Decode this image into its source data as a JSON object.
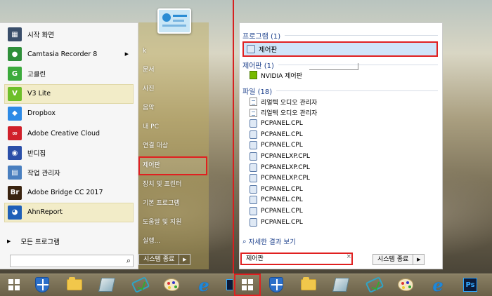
{
  "left_menu": {
    "apps": [
      {
        "label": "시작 화면",
        "icon": "start-screen-icon",
        "color": "#3a4e6a",
        "glyph": "▦",
        "arrow": false,
        "highlight": false
      },
      {
        "label": "Camtasia Recorder 8",
        "icon": "camtasia-icon",
        "color": "#2f8f3a",
        "glyph": "●",
        "arrow": true,
        "highlight": false
      },
      {
        "label": "고클린",
        "icon": "goclean-icon",
        "color": "#3caa3c",
        "glyph": "G",
        "arrow": false,
        "highlight": false
      },
      {
        "label": "V3 Lite",
        "icon": "v3-icon",
        "color": "#6dbf2a",
        "glyph": "V",
        "arrow": false,
        "highlight": true
      },
      {
        "label": "Dropbox",
        "icon": "dropbox-icon",
        "color": "#2d8ae6",
        "glyph": "◆",
        "arrow": false,
        "highlight": false
      },
      {
        "label": "Adobe Creative Cloud",
        "icon": "creative-cloud-icon",
        "color": "#d0202a",
        "glyph": "∞",
        "arrow": false,
        "highlight": false
      },
      {
        "label": "반디집",
        "icon": "bandizip-icon",
        "color": "#2b4fa8",
        "glyph": "◉",
        "arrow": false,
        "highlight": false
      },
      {
        "label": "작업 관리자",
        "icon": "task-manager-icon",
        "color": "#4a7fbf",
        "glyph": "▤",
        "arrow": false,
        "highlight": false
      },
      {
        "label": "Adobe Bridge CC 2017",
        "icon": "adobe-bridge-icon",
        "color": "#3a2410",
        "glyph": "Br",
        "arrow": false,
        "highlight": false
      },
      {
        "label": "AhnReport",
        "icon": "ahnreport-icon",
        "color": "#1e5fb8",
        "glyph": "◕",
        "arrow": false,
        "highlight": true
      }
    ],
    "all_programs": "모든 프로그램",
    "search_placeholder": ""
  },
  "right_column": {
    "links": [
      {
        "label": "k",
        "boxed": false
      },
      {
        "label": "문서",
        "boxed": false
      },
      {
        "label": "사진",
        "boxed": false
      },
      {
        "label": "음악",
        "boxed": false
      },
      {
        "label": "내 PC",
        "boxed": false
      },
      {
        "label": "연결 대상",
        "boxed": false
      },
      {
        "label": "제어판",
        "boxed": true
      },
      {
        "label": "장치 및 프린터",
        "boxed": false
      },
      {
        "label": "기본 프로그램",
        "boxed": false
      },
      {
        "label": "도움말 및 지원",
        "boxed": false
      },
      {
        "label": "실행...",
        "boxed": false
      }
    ],
    "shutdown": "시스템 종료"
  },
  "results": {
    "programs_header": "프로그램 (1)",
    "programs_item": "제어판",
    "control_panel_header": "제어판 (1)",
    "control_panel_item": "NVIDIA 제어판",
    "files_header": "파일 (18)",
    "files": [
      {
        "name": "리얼텍 오디오 관리자",
        "icon": "file"
      },
      {
        "name": "리얼텍 오디오 관리자",
        "icon": "file"
      },
      {
        "name": "PCPANEL.CPL",
        "icon": "cpl"
      },
      {
        "name": "PCPANEL.CPL",
        "icon": "cpl"
      },
      {
        "name": "PCPANEL.CPL",
        "icon": "cpl"
      },
      {
        "name": "PCPANELXP.CPL",
        "icon": "cpl"
      },
      {
        "name": "PCPANELXP.CPL",
        "icon": "cpl"
      },
      {
        "name": "PCPANELXP.CPL",
        "icon": "cpl"
      },
      {
        "name": "PCPANEL.CPL",
        "icon": "cpl"
      },
      {
        "name": "PCPANEL.CPL",
        "icon": "cpl"
      },
      {
        "name": "PCPANEL.CPL",
        "icon": "cpl"
      },
      {
        "name": "PCPANEL.CPL",
        "icon": "cpl"
      }
    ],
    "see_more": "자세한 결과 보기",
    "search_value": "제어판",
    "clear": "×",
    "shutdown": "시스템 종료"
  },
  "taskbar": {
    "left_icons": [
      "windows-start-icon",
      "defender-shield-icon",
      "file-explorer-icon",
      "notebook-icon",
      "drawing-tool-icon",
      "paint-palette-icon",
      "internet-explorer-icon"
    ],
    "right_icons": [
      "windows-start-icon",
      "defender-shield-icon",
      "file-explorer-icon",
      "notebook-icon",
      "drawing-tool-icon",
      "paint-palette-icon",
      "internet-explorer-icon",
      "photoshop-icon"
    ],
    "ie_glyph": "e",
    "ps_label": "Ps"
  },
  "colors": {
    "highlight_red": "#e02020",
    "selection_blue": "#cfe4f8",
    "header_blue": "#1a3e8a"
  }
}
